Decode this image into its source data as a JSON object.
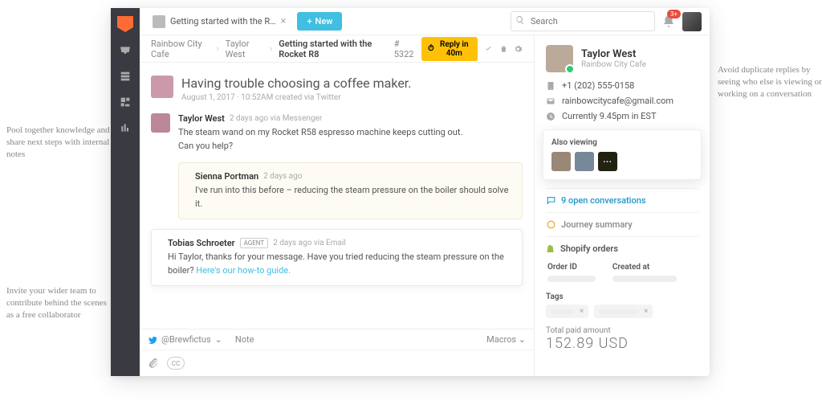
{
  "annotations": {
    "left1": "Pool together knowledge and share next steps with internal notes",
    "left2": "Invite your wider team to contribute behind the scenes as a free collaborator",
    "right1": "Avoid duplicate replies by seeing who else is viewing or working on a conversation"
  },
  "topbar": {
    "tab_title": "Getting started with the R…",
    "new_btn": "New",
    "search_placeholder": "Search",
    "notif_badge": "3+"
  },
  "breadcrumbs": {
    "org": "Rainbow City Cafe",
    "person": "Taylor West",
    "title": "Getting started with the Rocket R8",
    "ticket": "# 5322",
    "reply_in": "Reply in 40m"
  },
  "subject": {
    "title": "Having trouble choosing a coffee maker.",
    "meta": "August 1, 2017 · 10:52AM created via Twitter"
  },
  "msg1": {
    "name": "Taylor West",
    "meta": "2 days ago via Messenger",
    "line1": "The steam wand on my Rocket R58 espresso machine keeps cutting out.",
    "line2": "Can you help?"
  },
  "note": {
    "name": "Sienna Portman",
    "meta": "2 days ago",
    "text": "I've run into this before – reducing the steam pressure on the boiler should solve it."
  },
  "reply": {
    "name": "Tobias Schroeter",
    "badge": "AGENT",
    "meta": "2 days ago via Email",
    "text": "Hi Taylor, thanks for your message. Have you tried reducing the steam pressure on the boiler? ",
    "link": "Here's our how-to guide."
  },
  "compose": {
    "handle": "@Brewfictus",
    "note_tab": "Note",
    "macros": "Macros",
    "cc": "CC"
  },
  "profile": {
    "name": "Taylor West",
    "org": "Rainbow City Cafe",
    "phone": "+1 (202) 555-0158",
    "email": "rainbowcitycafe@gmail.com",
    "time": "Currently 9.45pm in EST",
    "also_viewing": "Also viewing",
    "open_convos": "9 open conversations",
    "journey": "Journey summary",
    "shopify": "Shopify orders",
    "col_order": "Order ID",
    "col_created": "Created at",
    "tags": "Tags",
    "total_lbl": "Total paid amount",
    "total_amt": "152.89 USD"
  }
}
